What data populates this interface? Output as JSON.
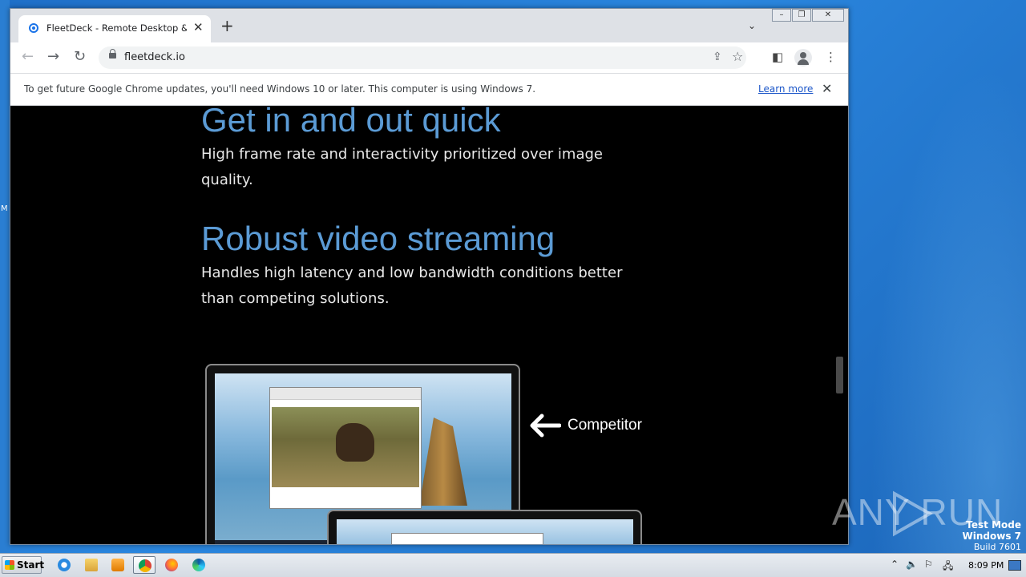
{
  "desktop": {
    "edge_letter": "M"
  },
  "browser": {
    "tab_title": "FleetDeck - Remote Desktop & Virtual Terminal",
    "tab_close": "✕",
    "new_tab": "+",
    "tab_search": "⌄",
    "window_controls": {
      "minimize": "–",
      "restore": "❐",
      "close": "✕"
    },
    "url": "fleetdeck.io",
    "back": "←",
    "forward": "→",
    "reload": "↻",
    "share": "⇪",
    "star": "☆",
    "side_panel": "◧",
    "menu": "⋮"
  },
  "infobar": {
    "message": "To get future Google Chrome updates, you'll need Windows 10 or later. This computer is using Windows 7.",
    "link": "Learn more",
    "close": "✕"
  },
  "page": {
    "section1": {
      "heading": "Get in and out quick",
      "body": "High frame rate and interactivity prioritized over image quality."
    },
    "section2": {
      "heading": "Robust video streaming",
      "body": "Handles high latency and low bandwidth conditions better than competing solutions."
    },
    "figure": {
      "label": "Competitor"
    }
  },
  "watermark": {
    "brand": "ANY RUN",
    "test_mode": "Test Mode",
    "os": "Windows 7",
    "build": "Build 7601"
  },
  "taskbar": {
    "start_label": "Start",
    "apps": [
      "internet-explorer-icon",
      "explorer-icon",
      "media-player-icon",
      "chrome-icon",
      "firefox-icon",
      "edge-icon"
    ],
    "clock": "8:09 PM",
    "tray": {
      "up": "⌃",
      "volume": "🔈",
      "flag": "⚐",
      "network": "🖧"
    }
  },
  "colors": {
    "heading": "#5b9bd5",
    "link": "#1a55c8",
    "page_bg": "#000000"
  }
}
